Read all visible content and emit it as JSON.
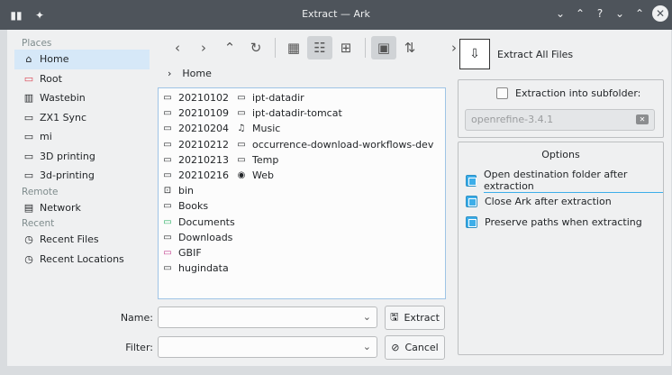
{
  "window": {
    "title": "Extract — Ark"
  },
  "places": {
    "headers": {
      "places": "Places",
      "remote": "Remote",
      "recent": "Recent"
    },
    "items": [
      {
        "label": "Home",
        "icon": "home-icon"
      },
      {
        "label": "Root",
        "icon": "folder-red-icon"
      },
      {
        "label": "Wastebin",
        "icon": "trash-icon"
      },
      {
        "label": "ZX1 Sync",
        "icon": "folder-icon"
      },
      {
        "label": "mi",
        "icon": "folder-icon"
      },
      {
        "label": "3D printing",
        "icon": "folder-icon"
      },
      {
        "label": "3d-printing",
        "icon": "folder-icon"
      }
    ],
    "remote_items": [
      {
        "label": "Network",
        "icon": "network-icon"
      }
    ],
    "recent_items": [
      {
        "label": "Recent Files",
        "icon": "recent-files-icon"
      },
      {
        "label": "Recent Locations",
        "icon": "recent-locations-icon"
      }
    ]
  },
  "breadcrumb": {
    "location": "Home"
  },
  "files": {
    "column1": [
      {
        "name": "20210102",
        "icon": "folder-icon"
      },
      {
        "name": "20210109",
        "icon": "folder-icon"
      },
      {
        "name": "20210204",
        "icon": "folder-icon"
      },
      {
        "name": "20210212",
        "icon": "folder-icon"
      },
      {
        "name": "20210213",
        "icon": "folder-icon"
      },
      {
        "name": "20210216",
        "icon": "folder-icon"
      },
      {
        "name": "bin",
        "icon": "terminal-folder-icon"
      },
      {
        "name": "Books",
        "icon": "folder-icon"
      },
      {
        "name": "Documents",
        "icon": "folder-green-icon"
      },
      {
        "name": "Downloads",
        "icon": "folder-icon"
      },
      {
        "name": "GBIF",
        "icon": "folder-magenta-icon"
      },
      {
        "name": "hugindata",
        "icon": "folder-icon"
      }
    ],
    "column2": [
      {
        "name": "ipt-datadir",
        "icon": "folder-icon"
      },
      {
        "name": "ipt-datadir-tomcat",
        "icon": "folder-icon"
      },
      {
        "name": "Music",
        "icon": "music-icon"
      },
      {
        "name": "occurrence-download-workflows-dev",
        "icon": "folder-icon"
      },
      {
        "name": "Temp",
        "icon": "folder-icon"
      },
      {
        "name": "Web",
        "icon": "globe-icon"
      }
    ]
  },
  "form": {
    "name_label": "Name:",
    "name_value": "",
    "filter_label": "Filter:",
    "filter_value": "",
    "extract_button": "Extract",
    "cancel_button": "Cancel"
  },
  "right_panel": {
    "extract_all": "Extract All Files",
    "subfolder_label": "Extraction into subfolder:",
    "subfolder_checked": false,
    "subfolder_value": "openrefine-3.4.1",
    "options_title": "Options",
    "options": [
      {
        "label": "Open destination folder after extraction",
        "checked": true
      },
      {
        "label": "Close Ark after extraction",
        "checked": true
      },
      {
        "label": "Preserve paths when extracting",
        "checked": true
      }
    ]
  },
  "colors": {
    "titlebar": "#4e545b",
    "selection": "#d6e8f8",
    "accent": "#3daee9",
    "window_bg": "#eff0f1"
  }
}
